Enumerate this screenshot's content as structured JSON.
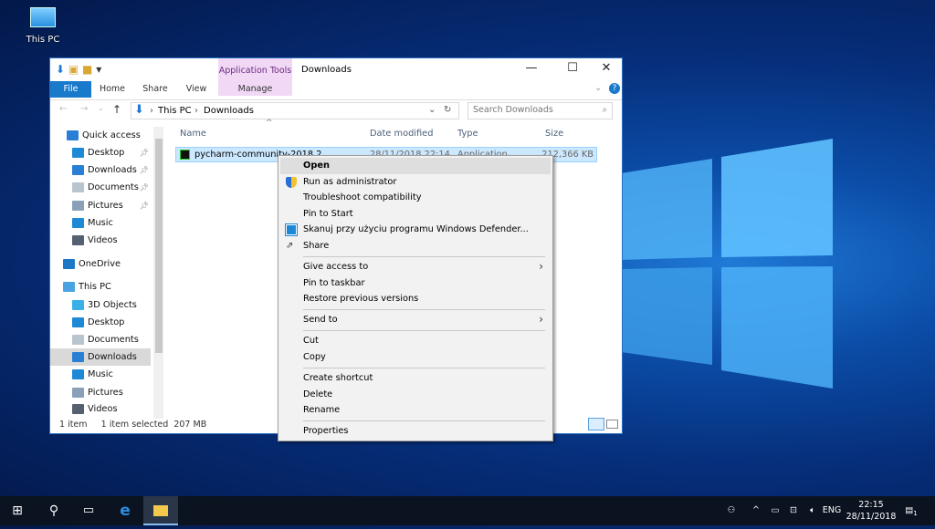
{
  "desktop": {
    "icons": [
      {
        "label": "This PC"
      }
    ]
  },
  "explorer": {
    "title": "Downloads",
    "contextual_tab": {
      "group": "Application Tools",
      "tab": "Manage"
    },
    "ribbon_tabs": [
      "File",
      "Home",
      "Share",
      "View"
    ],
    "breadcrumb": [
      "This PC",
      "Downloads"
    ],
    "search_placeholder": "Search Downloads",
    "columns": [
      "Name",
      "Date modified",
      "Type",
      "Size"
    ],
    "files": [
      {
        "name": "pycharm-community-2018.2",
        "date": "28/11/2018 22:14",
        "type": "Application",
        "size": "212,366 KB"
      }
    ],
    "nav": [
      {
        "label": "Quick access",
        "icon": "star-icon",
        "color": "#2a7fd4"
      },
      {
        "label": "Desktop",
        "icon": "desktop-icon",
        "color": "#1e8ad6",
        "pinned": true
      },
      {
        "label": "Downloads",
        "icon": "download-arrow-icon",
        "color": "#2a7fd4",
        "pinned": true
      },
      {
        "label": "Documents",
        "icon": "document-icon",
        "color": "#b8c4d0",
        "pinned": true
      },
      {
        "label": "Pictures",
        "icon": "pictures-icon",
        "color": "#8aa0b8",
        "pinned": true
      },
      {
        "label": "Music",
        "icon": "music-note-icon",
        "color": "#1e8ad6"
      },
      {
        "label": "Videos",
        "icon": "videos-icon",
        "color": "#556070"
      },
      {
        "label": "OneDrive",
        "icon": "cloud-icon",
        "color": "#1e78c8"
      },
      {
        "label": "This PC",
        "icon": "computer-icon",
        "color": "#4aa3e0"
      },
      {
        "label": "3D Objects",
        "icon": "cube-icon",
        "color": "#3ab0e8"
      },
      {
        "label": "Desktop",
        "icon": "desktop-icon",
        "color": "#1e8ad6"
      },
      {
        "label": "Documents",
        "icon": "document-icon",
        "color": "#b8c4d0"
      },
      {
        "label": "Downloads",
        "icon": "download-arrow-icon",
        "color": "#2a7fd4",
        "selected": true
      },
      {
        "label": "Music",
        "icon": "music-note-icon",
        "color": "#1e8ad6"
      },
      {
        "label": "Pictures",
        "icon": "pictures-icon",
        "color": "#8aa0b8"
      },
      {
        "label": "Videos",
        "icon": "videos-icon",
        "color": "#556070"
      }
    ],
    "status": {
      "count": "1 item",
      "selected": "1 item selected",
      "size": "207 MB"
    }
  },
  "context_menu": {
    "items": [
      {
        "label": "Open",
        "bold": true
      },
      {
        "label": "Run as administrator",
        "icon": "uac-shield-icon"
      },
      {
        "label": "Troubleshoot compatibility"
      },
      {
        "label": "Pin to Start"
      },
      {
        "label": "Skanuj przy użyciu programu Windows Defender...",
        "icon": "defender-icon"
      },
      {
        "label": "Share",
        "icon": "share-icon"
      },
      {
        "sep": true
      },
      {
        "label": "Give access to",
        "submenu": true
      },
      {
        "label": "Pin to taskbar"
      },
      {
        "label": "Restore previous versions"
      },
      {
        "sep": true
      },
      {
        "label": "Send to",
        "submenu": true
      },
      {
        "sep": true
      },
      {
        "label": "Cut"
      },
      {
        "label": "Copy"
      },
      {
        "sep": true
      },
      {
        "label": "Create shortcut"
      },
      {
        "label": "Delete"
      },
      {
        "label": "Rename"
      },
      {
        "sep": true
      },
      {
        "label": "Properties"
      }
    ]
  },
  "taskbar": {
    "language": "ENG",
    "time": "22:15",
    "date": "28/11/2018",
    "notifications": "1"
  },
  "colors": {
    "accent": "#1979ca",
    "selection": "#cce8ff",
    "contextual_tab": "#f1d9f6"
  }
}
